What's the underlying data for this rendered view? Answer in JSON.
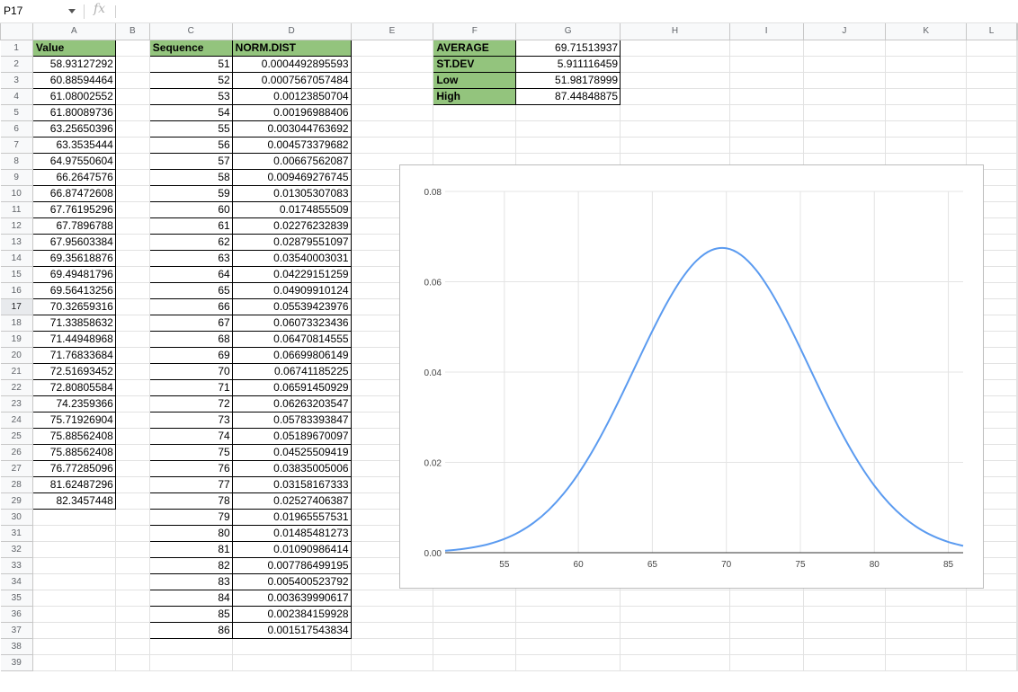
{
  "formula_bar": {
    "cell_ref": "P17",
    "fx_label": "fx",
    "formula": ""
  },
  "columns": [
    "A",
    "B",
    "C",
    "D",
    "E",
    "F",
    "G",
    "H",
    "I",
    "J",
    "K",
    "L"
  ],
  "active_row": 17,
  "headers": {
    "value": "Value",
    "sequence": "Sequence",
    "normdist": "NORM.DIST"
  },
  "values": [
    "58.93127292",
    "60.88594464",
    "61.08002552",
    "61.80089736",
    "63.25650396",
    "63.3535444",
    "64.97550604",
    "66.2647576",
    "66.87472608",
    "67.76195296",
    "67.7896788",
    "67.95603384",
    "69.35618876",
    "69.49481796",
    "69.56413256",
    "70.32659316",
    "71.33858632",
    "71.44948968",
    "71.76833684",
    "72.51693452",
    "72.80805584",
    "74.2359366",
    "75.71926904",
    "75.88562408",
    "75.88562408",
    "76.77285096",
    "81.62487296",
    "82.3457448"
  ],
  "sequence": [
    "51",
    "52",
    "53",
    "54",
    "55",
    "56",
    "57",
    "58",
    "59",
    "60",
    "61",
    "62",
    "63",
    "64",
    "65",
    "66",
    "67",
    "68",
    "69",
    "70",
    "71",
    "72",
    "73",
    "74",
    "75",
    "76",
    "77",
    "78",
    "79",
    "80",
    "81",
    "82",
    "83",
    "84",
    "85",
    "86"
  ],
  "normdist": [
    "0.0004492895593",
    "0.0007567057484",
    "0.00123850704",
    "0.00196988406",
    "0.003044763692",
    "0.004573379682",
    "0.00667562087",
    "0.009469276745",
    "0.01305307083",
    "0.0174855509",
    "0.02276232839",
    "0.02879551097",
    "0.03540003031",
    "0.04229151259",
    "0.04909910124",
    "0.05539423976",
    "0.06073323436",
    "0.06470814555",
    "0.06699806149",
    "0.06741185225",
    "0.06591450929",
    "0.06263203547",
    "0.05783393847",
    "0.05189670097",
    "0.04525509419",
    "0.03835005006",
    "0.03158167333",
    "0.02527406387",
    "0.01965557531",
    "0.01485481273",
    "0.01090986414",
    "0.007786499195",
    "0.005400523792",
    "0.003639990617",
    "0.002384159928",
    "0.001517543834"
  ],
  "stats": [
    {
      "label": "AVERAGE",
      "value": "69.71513937"
    },
    {
      "label": "ST.DEV",
      "value": "5.911116459"
    },
    {
      "label": "Low",
      "value": "51.98178999"
    },
    {
      "label": "High",
      "value": "87.44848875"
    }
  ],
  "chart_data": {
    "type": "line",
    "title": "",
    "xlabel": "",
    "ylabel": "",
    "x": [
      51,
      52,
      53,
      54,
      55,
      56,
      57,
      58,
      59,
      60,
      61,
      62,
      63,
      64,
      65,
      66,
      67,
      68,
      69,
      70,
      71,
      72,
      73,
      74,
      75,
      76,
      77,
      78,
      79,
      80,
      81,
      82,
      83,
      84,
      85,
      86
    ],
    "series": [
      {
        "values": [
          0.0004492895593,
          0.0007567057484,
          0.00123850704,
          0.00196988406,
          0.003044763692,
          0.004573379682,
          0.00667562087,
          0.009469276745,
          0.01305307083,
          0.0174855509,
          0.02276232839,
          0.02879551097,
          0.03540003031,
          0.04229151259,
          0.04909910124,
          0.05539423976,
          0.06073323436,
          0.06470814555,
          0.06699806149,
          0.06741185225,
          0.06591450929,
          0.06263203547,
          0.05783393847,
          0.05189670097,
          0.04525509419,
          0.03835005006,
          0.03158167333,
          0.02527406387,
          0.01965557531,
          0.01485481273,
          0.01090986414,
          0.007786499195,
          0.005400523792,
          0.003639990617,
          0.002384159928,
          0.001517543834
        ]
      }
    ],
    "xticks": [
      "55",
      "60",
      "65",
      "70",
      "75",
      "80",
      "85"
    ],
    "yticks": [
      "0.00",
      "0.02",
      "0.04",
      "0.06",
      "0.08"
    ],
    "xlim": [
      51,
      86
    ],
    "ylim": [
      0,
      0.08
    ],
    "grid": true,
    "line_color": "#5b9bf0"
  }
}
